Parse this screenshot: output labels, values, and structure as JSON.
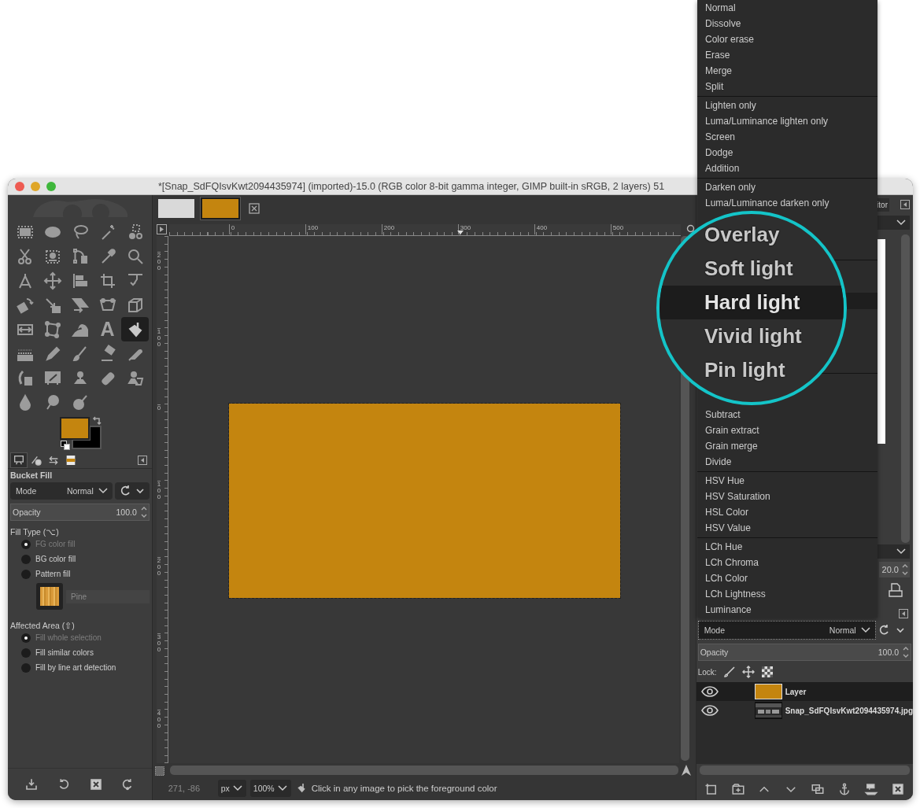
{
  "window": {
    "title": "*[Snap_SdFQIsvKwt2094435974] (imported)-15.0 (RGB color 8-bit gamma integer, GIMP built-in sRGB, 2 layers) 51"
  },
  "toolbox": {
    "tools": [
      {
        "selected": false
      },
      {
        "selected": false
      },
      {
        "selected": false
      },
      {
        "selected": false
      },
      {
        "selected": false
      },
      {
        "selected": false
      },
      {
        "selected": false
      },
      {
        "selected": false
      },
      {
        "selected": false
      },
      {
        "selected": false
      },
      {
        "selected": false
      },
      {
        "selected": false
      },
      {
        "selected": false
      },
      {
        "selected": false
      },
      {
        "selected": false
      },
      {
        "selected": false
      },
      {
        "selected": false
      },
      {
        "selected": false
      },
      {
        "selected": false
      },
      {
        "selected": false
      },
      {
        "selected": false
      },
      {
        "selected": false
      },
      {
        "selected": false
      },
      {
        "selected": false,
        "glyph": "A"
      },
      {
        "selected": true
      },
      {
        "selected": false
      },
      {
        "selected": false
      },
      {
        "selected": false
      },
      {
        "selected": false
      },
      {
        "selected": false
      },
      {
        "selected": false
      },
      {
        "selected": false
      },
      {
        "selected": false
      },
      {
        "selected": false
      },
      {
        "selected": false
      },
      {
        "selected": false
      },
      {
        "selected": false
      },
      {
        "selected": false
      }
    ],
    "foreground": {
      "color": "#c4850f"
    },
    "background": {
      "color": "#000000"
    }
  },
  "dock_tabs": [
    {
      "selected": true
    },
    {
      "selected": false
    },
    {
      "selected": false
    },
    {
      "selected": false
    }
  ],
  "tool_options": {
    "title": "Bucket Fill",
    "mode": {
      "label": "Mode",
      "value": "Normal"
    },
    "opacity": {
      "label": "Opacity",
      "value": "100.0"
    },
    "fill_type": {
      "label": "Fill Type  (⌥)",
      "options": [
        {
          "label": "FG color fill",
          "selected": true
        },
        {
          "label": "BG color fill",
          "selected": false
        },
        {
          "label": "Pattern fill",
          "selected": false
        }
      ]
    },
    "pattern": {
      "name": "Pine"
    },
    "affected_area": {
      "label": "Affected Area  (⇧)",
      "options": [
        {
          "label": "Fill whole selection",
          "selected": true
        },
        {
          "label": "Fill similar colors",
          "selected": false
        },
        {
          "label": "Fill by line art detection",
          "selected": false
        }
      ]
    }
  },
  "image_tabs": [
    {
      "selected": false
    },
    {
      "selected": true
    }
  ],
  "rulers": {
    "horizontal": [
      "0",
      "100",
      "200",
      "300",
      "400",
      "500"
    ],
    "vertical": [
      "200",
      "100",
      "0",
      "100",
      "200",
      "300",
      "400"
    ]
  },
  "status_bar": {
    "coordinates": "271, -86",
    "unit": "px",
    "zoom": "100%",
    "message": "Click in any image to pick the foreground color"
  },
  "right_dock": {
    "tab": "itor",
    "spinner": "20.0"
  },
  "layers_panel": {
    "mode": {
      "label": "Mode",
      "value": "Normal"
    },
    "opacity": {
      "label": "Opacity",
      "value": "100.0"
    },
    "lock_label": "Lock:",
    "layers": [
      {
        "name": "Layer",
        "visible": true,
        "selected": true,
        "kind": "fill"
      },
      {
        "name": "Snap_SdFQIsvKwt2094435974.jpg",
        "visible": true,
        "selected": false
      }
    ]
  },
  "blend_menu": {
    "groups": [
      {
        "items": [
          "Normal",
          "Dissolve",
          "Color erase",
          "Erase",
          "Merge",
          "Split"
        ]
      },
      {
        "items": [
          "Lighten only",
          "Luma/Luminance lighten only",
          "Screen",
          "Dodge",
          "Addition"
        ]
      },
      {
        "items": [
          "Darken only",
          "Luma/Luminance darken only"
        ]
      },
      {
        "items": [
          "Subtract",
          "Grain extract",
          "Grain merge",
          "Divide"
        ]
      },
      {
        "items": [
          "HSV Hue",
          "HSV Saturation",
          "HSL Color",
          "HSV Value"
        ]
      },
      {
        "items": [
          "LCh Hue",
          "LCh Chroma",
          "LCh Color",
          "LCh Lightness",
          "Luminance"
        ]
      }
    ],
    "magnifier": {
      "items": [
        {
          "label": "Overlay",
          "selected": false
        },
        {
          "label": "Soft light",
          "selected": false
        },
        {
          "label": "Hard light",
          "selected": true
        },
        {
          "label": "Vivid light",
          "selected": false
        },
        {
          "label": "Pin light",
          "selected": false
        }
      ]
    }
  }
}
